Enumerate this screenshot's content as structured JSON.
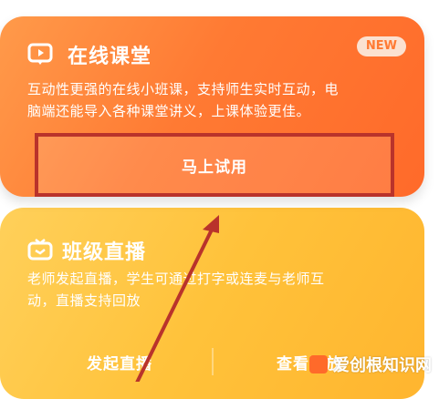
{
  "online_class": {
    "icon": "chat-screen-icon",
    "title": "在线课堂",
    "badge": "NEW",
    "description_line1": "互动性更强的在线小班课，支持师生实时互动，电",
    "description_line2": "脑端还能导入各种课堂讲义，上课体验更佳。",
    "button_label": "马上试用"
  },
  "class_live": {
    "icon": "tv-icon",
    "title": "班级直播",
    "description_line1": "老师发起直播，学生可通过打字或连麦与老师互",
    "description_line2": "动，直播支持回放",
    "start_live_label": "发起直播",
    "view_playback_label": "查看回放"
  },
  "watermark": {
    "text": "爱创根知识网"
  },
  "colors": {
    "online_card": "#ff7a33",
    "live_card": "#ffc23a",
    "highlight_box": "#b9332b",
    "arrow": "#b9332b"
  }
}
